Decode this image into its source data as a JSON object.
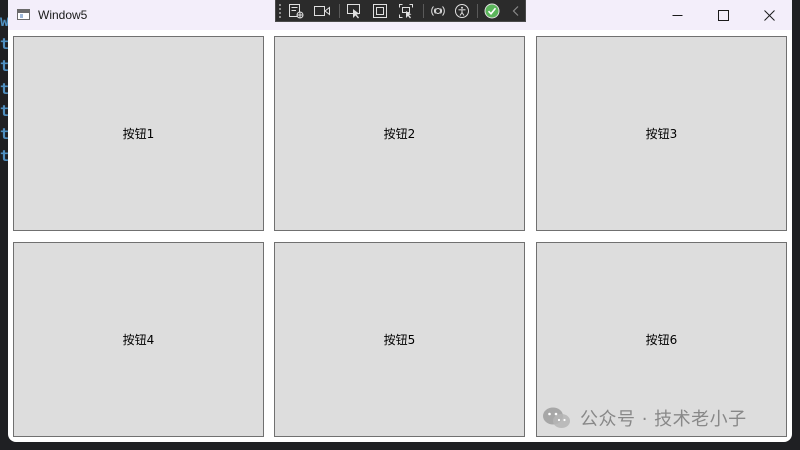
{
  "background": {
    "code_fragments": [
      "w",
      "t",
      "t",
      "t",
      "t",
      "t",
      "t"
    ]
  },
  "window": {
    "title": "Window5",
    "controls": {
      "minimize_icon": "minimize-icon",
      "maximize_icon": "maximize-icon",
      "close_icon": "close-icon"
    }
  },
  "debug_toolbar": {
    "items": [
      "live-visual-tree-icon",
      "record-icon",
      "select-element-icon",
      "display-layout-adorners-icon",
      "track-focused-element-icon",
      "hot-reload-icon",
      "accessibility-icon",
      "binding-check-icon",
      "collapse-chevron-icon"
    ]
  },
  "buttons": [
    {
      "label": "按钮1"
    },
    {
      "label": "按钮2"
    },
    {
      "label": "按钮3"
    },
    {
      "label": "按钮4"
    },
    {
      "label": "按钮5"
    },
    {
      "label": "按钮6"
    }
  ],
  "watermark": {
    "text": "公众号 · 技术老小子",
    "icon": "wechat-icon"
  },
  "colors": {
    "titlebar": "#f3eefa",
    "button_face": "#dddddd",
    "button_border": "#707070",
    "toolbar": "#2b2b2b",
    "background_code": "#4f8fc0"
  }
}
